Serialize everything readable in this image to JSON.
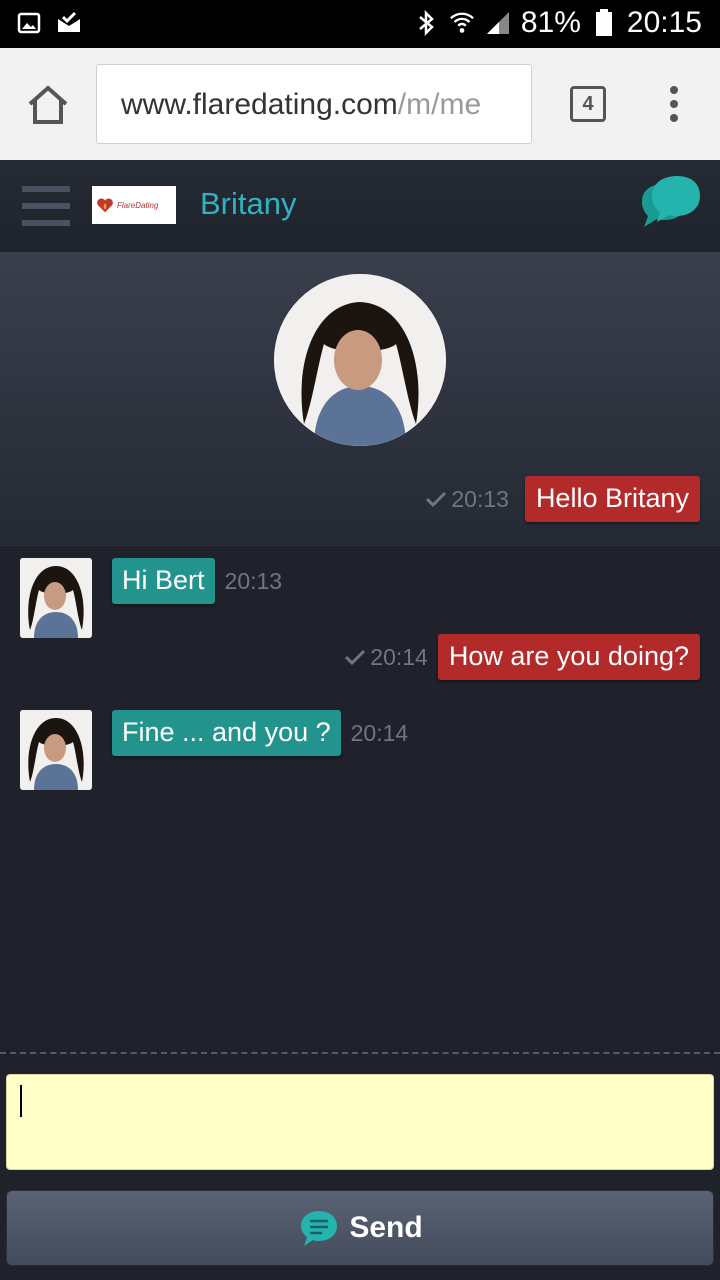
{
  "status_bar": {
    "battery": "81%",
    "time": "20:15",
    "icons": [
      "gallery-icon",
      "mail-check-icon",
      "bluetooth-icon",
      "wifi-icon",
      "signal-icon",
      "battery-icon"
    ]
  },
  "browser": {
    "url_host": "www.flaredating.com",
    "url_path": "/m/me",
    "tab_count": "4"
  },
  "header": {
    "logo_text": "FlareDating",
    "contact_name": "Britany"
  },
  "messages": [
    {
      "direction": "out",
      "text": "Hello Britany",
      "time": "20:13",
      "read": true
    },
    {
      "direction": "in",
      "text": "Hi Bert",
      "time": "20:13"
    },
    {
      "direction": "out",
      "text": "How are you doing?",
      "time": "20:14",
      "read": true
    },
    {
      "direction": "in",
      "text": "Fine ... and you ?",
      "time": "20:14"
    }
  ],
  "composer": {
    "value": "",
    "send_label": "Send"
  },
  "colors": {
    "accent": "#2fb3c2",
    "outgoing_bubble": "#b22a2a",
    "incoming_bubble": "#22938d",
    "input_bg": "#ffffc8"
  }
}
